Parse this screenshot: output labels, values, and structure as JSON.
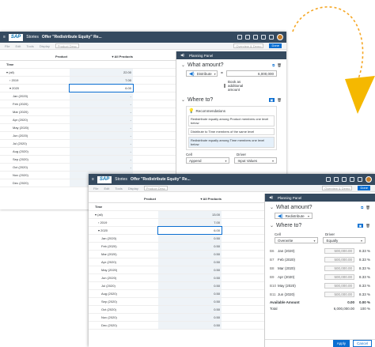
{
  "w1": {
    "shell": {
      "stories": "Stories",
      "title": "Offer \"Redistribute Equity\" Re..."
    },
    "toolbar": {
      "items": [
        "File",
        "Edit",
        "Tools",
        "Display",
        "Product Desc"
      ],
      "search": "Overview & Demo",
      "apply": "Done"
    },
    "grid": {
      "col_product": "Product",
      "col_all": "All Products",
      "row_header": "Time",
      "rows": [
        {
          "label": "(all)",
          "value": "22.00",
          "lvl": "l0",
          "arrow": "▾"
        },
        {
          "label": "2019",
          "value": "7.00",
          "lvl": "l1",
          "arrow": "›"
        },
        {
          "label": "2020",
          "value": "6.00",
          "lvl": "l1",
          "arrow": "▾",
          "sel": true
        },
        {
          "label": "Jan (2020)",
          "value": "-"
        },
        {
          "label": "Feb (2020)",
          "value": "-"
        },
        {
          "label": "Mar (2020)",
          "value": "-"
        },
        {
          "label": "Apr (2020)",
          "value": "-"
        },
        {
          "label": "May (2020)",
          "value": "-"
        },
        {
          "label": "Jun (2020)",
          "value": "-"
        },
        {
          "label": "Jul (2020)",
          "value": "-"
        },
        {
          "label": "Aug (2020)",
          "value": "-"
        },
        {
          "label": "Sep (2020)",
          "value": "-"
        },
        {
          "label": "Oct (2020)",
          "value": "-"
        },
        {
          "label": "Nov (2020)",
          "value": "-"
        },
        {
          "label": "Dec (2020)",
          "value": "-"
        }
      ]
    },
    "panel": {
      "title": "Planning Panel",
      "what_amount": "What amount?",
      "mode": "Distribute",
      "eq": "=",
      "amount": "6,000,000",
      "book": "Book as additional amount",
      "where_to": "Where to?",
      "recommendations": "Recommendations",
      "recs": [
        "Redistribute equally among Product members one level below",
        "Distribute to Time members of the same level",
        "Redistribute equally among Time members one level below"
      ],
      "cell_label": "Cell",
      "driver_label": "Driver",
      "cell_value": "Append",
      "driver_value": "Input Values"
    }
  },
  "w2": {
    "shell": {
      "stories": "Stories",
      "title": "Offer \"Redistribute Equity\" Re..."
    },
    "toolbar": {
      "items": [
        "File",
        "Edit",
        "Tools",
        "Display",
        "Product Desc"
      ],
      "search": "Overview & Demo",
      "apply": "Done"
    },
    "grid": {
      "col_product": "Product",
      "col_all": "All Products",
      "row_header": "Time",
      "rows": [
        {
          "label": "(all)",
          "value": "13.00",
          "lvl": "l0",
          "arrow": "▾"
        },
        {
          "label": "2019",
          "value": "7.00",
          "lvl": "l1",
          "arrow": "›"
        },
        {
          "label": "2020",
          "value": "6.00",
          "lvl": "l1",
          "arrow": "▾",
          "sel": true
        },
        {
          "label": "Jan (2020)",
          "value": "0.50"
        },
        {
          "label": "Feb (2020)",
          "value": "0.50"
        },
        {
          "label": "Mar (2020)",
          "value": "0.50"
        },
        {
          "label": "Apr (2020)",
          "value": "0.50"
        },
        {
          "label": "May (2020)",
          "value": "0.50"
        },
        {
          "label": "Jun (2020)",
          "value": "0.50"
        },
        {
          "label": "Jul (2020)",
          "value": "0.50"
        },
        {
          "label": "Aug (2020)",
          "value": "0.50"
        },
        {
          "label": "Sep (2020)",
          "value": "0.50"
        },
        {
          "label": "Oct (2020)",
          "value": "0.50"
        },
        {
          "label": "Nov (2020)",
          "value": "0.50"
        },
        {
          "label": "Dec (2020)",
          "value": "0.50"
        }
      ]
    },
    "panel": {
      "title": "Planning Panel",
      "what_amount": "What amount?",
      "mode": "Redistribute",
      "where_to": "Where to?",
      "cell_label": "Cell",
      "driver_label": "Driver",
      "cell_value": "Overwrite",
      "driver_value": "Equally",
      "targets": [
        {
          "key": "B6",
          "month": "Jan (2020)",
          "amount": "500,000.00",
          "pct": "8.33 %"
        },
        {
          "key": "B7",
          "month": "Feb (2020)",
          "amount": "500,000.00",
          "pct": "8.33 %"
        },
        {
          "key": "B8",
          "month": "Mar (2020)",
          "amount": "500,000.00",
          "pct": "8.33 %"
        },
        {
          "key": "B9",
          "month": "Apr (2020)",
          "amount": "500,000.00",
          "pct": "8.33 %"
        },
        {
          "key": "B10",
          "month": "May (2020)",
          "amount": "500,000.00",
          "pct": "8.33 %"
        },
        {
          "key": "B11",
          "month": "Jun (2020)",
          "amount": "500,000.00",
          "pct": "8.33 %"
        }
      ],
      "available_label": "Available Amount",
      "available_amount": "0.00",
      "available_pct": "0.00 %",
      "total_label": "Total",
      "total_amount": "6,000,000.00",
      "total_pct": "100 %",
      "apply": "Apply",
      "cancel": "Cancel"
    }
  },
  "colors": {
    "shell": "#354a5f",
    "accent": "#0a6ed1",
    "arrow": "#f5b800",
    "dotted": "#f5a623"
  }
}
